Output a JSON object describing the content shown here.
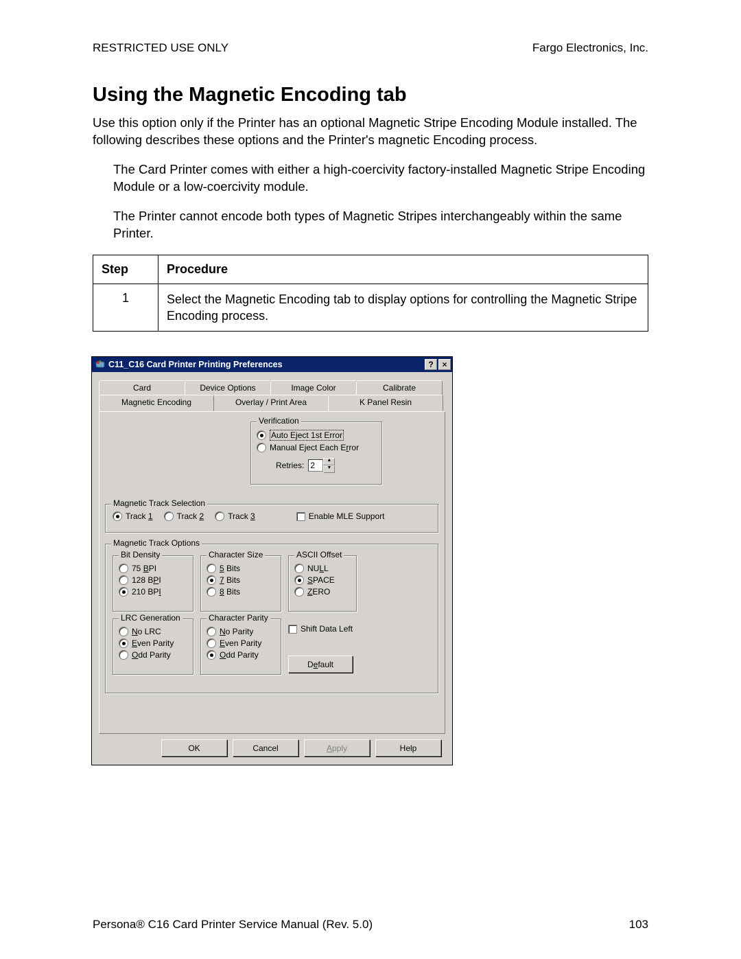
{
  "header": {
    "left": "RESTRICTED USE ONLY",
    "right": "Fargo Electronics, Inc."
  },
  "page": {
    "title": "Using the Magnetic Encoding tab",
    "intro": "Use this option only if the Printer has an optional Magnetic Stripe Encoding Module installed. The following describes these options and the Printer's magnetic Encoding process.",
    "bullet1": "The Card Printer comes with either a high-coercivity factory-installed Magnetic Stripe Encoding Module or a low-coercivity module.",
    "bullet2": "The Printer cannot encode both types of Magnetic Stripes interchangeably within the same Printer.",
    "table": {
      "h_step": "Step",
      "h_proc": "Procedure",
      "step": "1",
      "proc": "Select the Magnetic Encoding tab to display options for controlling the Magnetic Stripe Encoding process."
    }
  },
  "dialog": {
    "title": "C11_C16 Card Printer Printing Preferences",
    "help_btn": "?",
    "close_btn": "×",
    "tabs_back": [
      "Card",
      "Device Options",
      "Image Color",
      "Calibrate"
    ],
    "tabs_front": [
      "Magnetic Encoding",
      "Overlay / Print Area",
      "K Panel Resin"
    ],
    "verification": {
      "legend": "Verification",
      "opt1_pre": "Auto E",
      "opt1_u": "j",
      "opt1_post": "ect 1st Error",
      "opt2_pre": "Manual Eject Each E",
      "opt2_u": "r",
      "opt2_post": "ror",
      "retries_label": "Retries:",
      "retries_value": "2"
    },
    "track_sel": {
      "legend": "Magnetic Track Selection",
      "t1_pre": "Track ",
      "t1_u": "1",
      "t2_pre": "Track ",
      "t2_u": "2",
      "t3_pre": "Track ",
      "t3_u": "3",
      "mle": "Enable MLE Support"
    },
    "track_opt_legend": "Magnetic Track Options",
    "bit_density": {
      "legend": "Bit Density",
      "o1a": "  75 ",
      "o1u": "B",
      "o1b": "PI",
      "o2a": "128 B",
      "o2u": "P",
      "o2b": "I",
      "o3a": "210 BP",
      "o3u": "I",
      "o3b": ""
    },
    "char_size": {
      "legend": "Character Size",
      "o1u": "5",
      "o1b": " Bits",
      "o2u": "7",
      "o2b": " Bits",
      "o3u": "8",
      "o3b": " Bits"
    },
    "ascii_offset": {
      "legend": "ASCII Offset",
      "o1a": "NU",
      "o1u": "L",
      "o1b": "L",
      "o2u": "S",
      "o2b": "PACE",
      "o3u": "Z",
      "o3b": "ERO"
    },
    "lrc": {
      "legend": "LRC Generation",
      "o1u": "N",
      "o1b": "o LRC",
      "o2u": "E",
      "o2b": "ven Parity",
      "o3u": "O",
      "o3b": "dd Parity"
    },
    "char_parity": {
      "legend": "Character Parity",
      "o1u": "N",
      "o1b": "o Parity",
      "o2u": "E",
      "o2b": "ven Parity",
      "o3u": "O",
      "o3b": "dd Parity"
    },
    "shift_data": "Shift Data Left",
    "default_btn_pre": "D",
    "default_btn_u": "e",
    "default_btn_post": "fault",
    "buttons": {
      "ok": "OK",
      "cancel": "Cancel",
      "apply_u": "A",
      "apply_post": "pply",
      "help": "Help"
    }
  },
  "footer": {
    "left": "Persona® C16 Card Printer Service Manual (Rev. 5.0)",
    "right": "103"
  }
}
